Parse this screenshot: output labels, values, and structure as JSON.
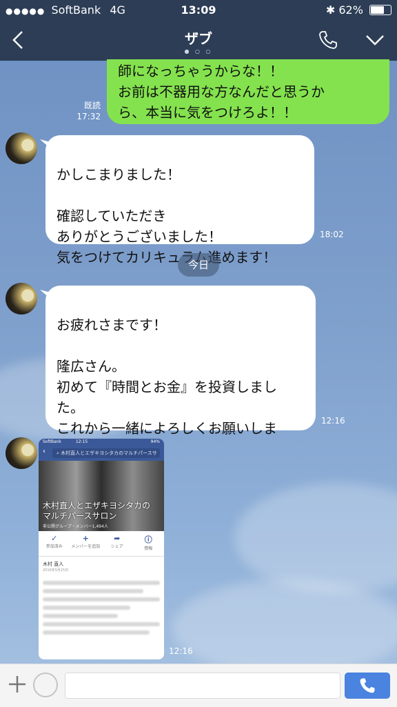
{
  "status_bar": {
    "carrier": "SoftBank",
    "network": "4G",
    "time": "13:09",
    "battery": "62%"
  },
  "header": {
    "title": "ザブ"
  },
  "messages": {
    "outgoing_top": {
      "text": "師になっちゃうからな！！\nお前は不器用な方なんだと思うか\nら、本当に気をつけろよ！！",
      "read_label": "既読",
      "time": "17:32"
    },
    "incoming_1": {
      "text": "かしこまりました！\n\n確認していただき\nありがとうございました！\n気をつけてカリキュラム進めます！",
      "time": "18:02"
    },
    "date_divider": "今日",
    "incoming_2": {
      "text": "お疲れさまです！\n\n隆広さん。\n初めて『時間とお金』を投資しまし\nた。\nこれから一緒によろしくお願いしま\nす。",
      "time": "12:16"
    },
    "incoming_image": {
      "time": "12:16",
      "inner_status": {
        "carrier": "SoftBank",
        "time": "12:15",
        "battery": "94%"
      },
      "search_text": "木村直人とエザキヨシタカのマルチパースサ",
      "photo_caption": "木村直人とエザキヨシタカの\nマルチパースサロン",
      "photo_sub": "非公開グループ・メンバー1,494人",
      "actions": [
        "参加済み",
        "メンバーを追加",
        "シェア",
        "情報"
      ],
      "post_author": "木村 直人",
      "post_date": "2016年5月25日"
    }
  },
  "colors": {
    "header_bg": "#2d3d56",
    "outgoing_bubble": "#84e24e",
    "call_button": "#4a83e0"
  }
}
